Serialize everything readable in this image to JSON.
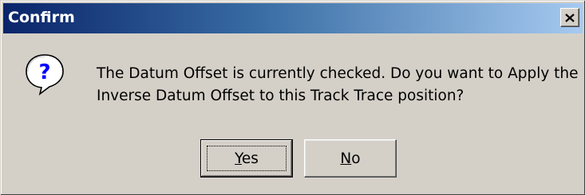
{
  "window": {
    "title": "Confirm",
    "close_icon": "close-icon",
    "titlebar_colors": [
      "#0a246a",
      "#a6caf0"
    ]
  },
  "dialog": {
    "icon": "question-icon",
    "message": "The Datum Offset is currently checked. Do you want to Apply the Inverse Datum Offset to this Track Trace position?"
  },
  "buttons": {
    "yes": {
      "accel": "Y",
      "rest": "es",
      "default": true
    },
    "no": {
      "accel": "N",
      "rest": "o",
      "default": false
    }
  }
}
